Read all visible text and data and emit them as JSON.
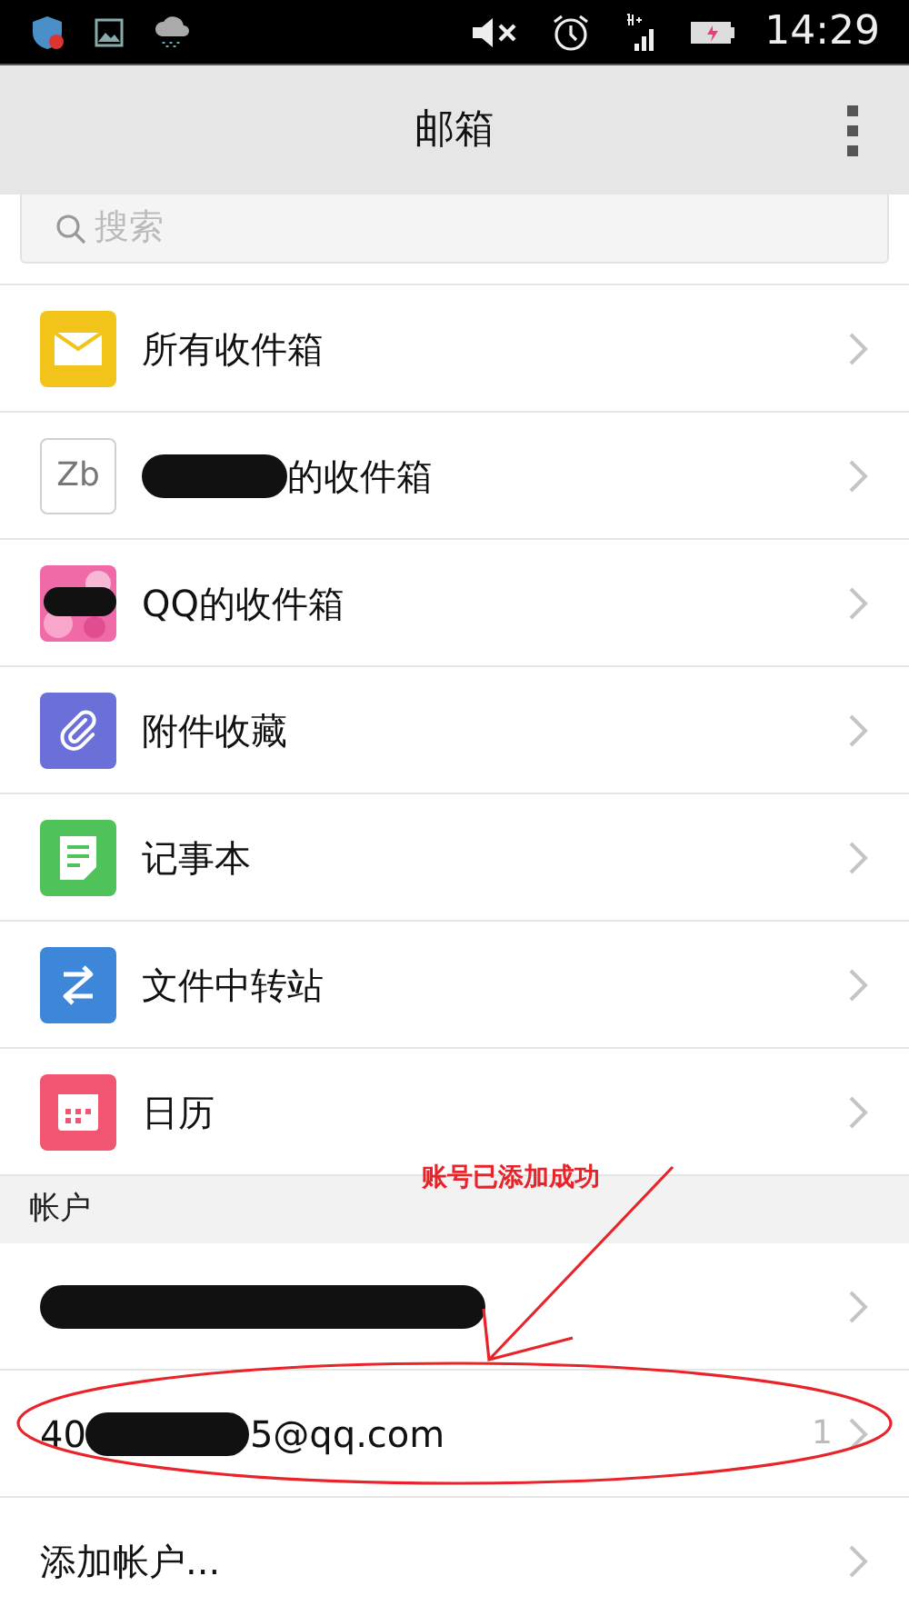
{
  "status_bar": {
    "time": "14:29"
  },
  "title": "邮箱",
  "search": {
    "placeholder": "搜索"
  },
  "mailboxes": [
    {
      "kind": "mail",
      "label": "所有收件箱",
      "color": "#f2c318"
    },
    {
      "kind": "initials",
      "initials": "Zb",
      "label": "的收件箱",
      "redacted": true
    },
    {
      "label": "QQ的收件箱",
      "redacted": true
    },
    {
      "kind": "attachment",
      "label": "附件收藏",
      "color": "#6b6fd8"
    },
    {
      "kind": "note",
      "label": "记事本",
      "color": "#4fc25a"
    },
    {
      "kind": "transfer",
      "label": "文件中转站",
      "color": "#3d86d8"
    },
    {
      "kind": "calendar",
      "label": "日历",
      "color": "#f0566f"
    }
  ],
  "accounts_header": "帐户",
  "accounts": [
    {
      "redacted": true
    },
    {
      "prefix": "40",
      "suffix": "5@qq.com",
      "redacted": true,
      "count": "1"
    }
  ],
  "add_account": "添加帐户...",
  "annotation": {
    "text": "账号已添加成功"
  }
}
